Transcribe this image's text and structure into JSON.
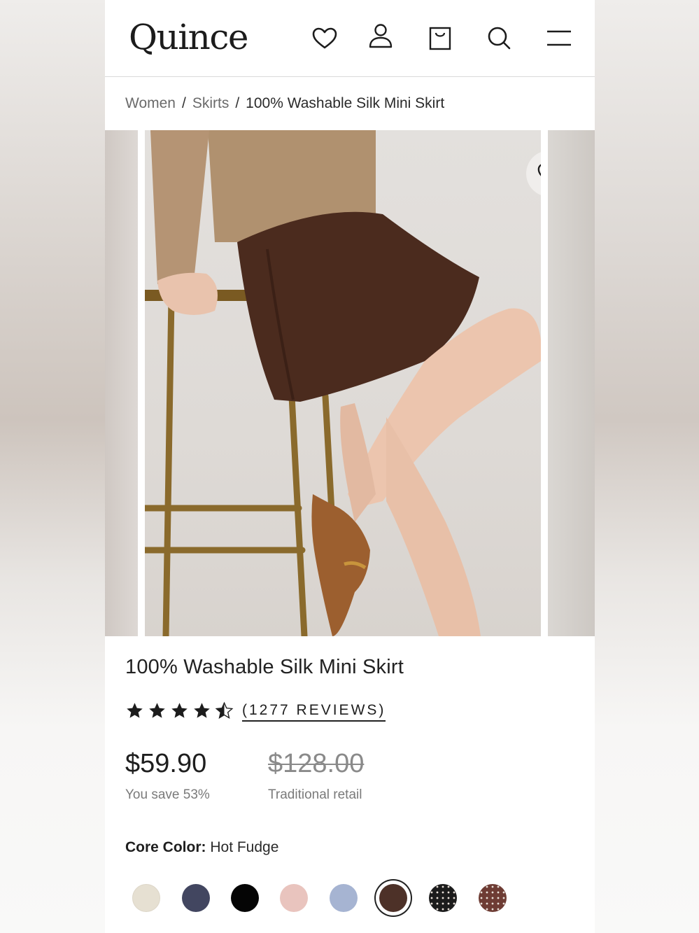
{
  "header": {
    "logo": "Quince",
    "icons": [
      "heart-icon",
      "account-icon",
      "bag-icon",
      "search-icon",
      "menu-icon"
    ]
  },
  "breadcrumb": {
    "items": [
      "Women",
      "Skirts"
    ],
    "separator": "/",
    "current": "100% Washable Silk Mini Skirt"
  },
  "product": {
    "title": "100% Washable Silk Mini Skirt",
    "rating": 4.5,
    "reviews_label": "(1277 REVIEWS)",
    "price": "$59.90",
    "price_note": "You save 53%",
    "retail_price": "$128.00",
    "retail_note": "Traditional retail",
    "color_label": "Core Color:",
    "color_value": "Hot Fudge"
  },
  "swatches": [
    {
      "name": "swatch-ivory",
      "color": "#e6e0d2"
    },
    {
      "name": "swatch-navy",
      "color": "#424660"
    },
    {
      "name": "swatch-black",
      "color": "#050505"
    },
    {
      "name": "swatch-blush",
      "color": "#e9c4be"
    },
    {
      "name": "swatch-blue",
      "color": "#a6b4d2"
    },
    {
      "name": "swatch-hot-fudge",
      "color": "#4d3128",
      "selected": true
    },
    {
      "name": "swatch-black-dot",
      "color": "#1c1c1c",
      "pattern": "dots"
    },
    {
      "name": "swatch-brown-dot",
      "color": "#6e3c34",
      "pattern": "dots"
    }
  ],
  "colors": {
    "text": "#1f1f1f",
    "muted": "#7a7a7a",
    "divider": "#d9d9d9"
  }
}
